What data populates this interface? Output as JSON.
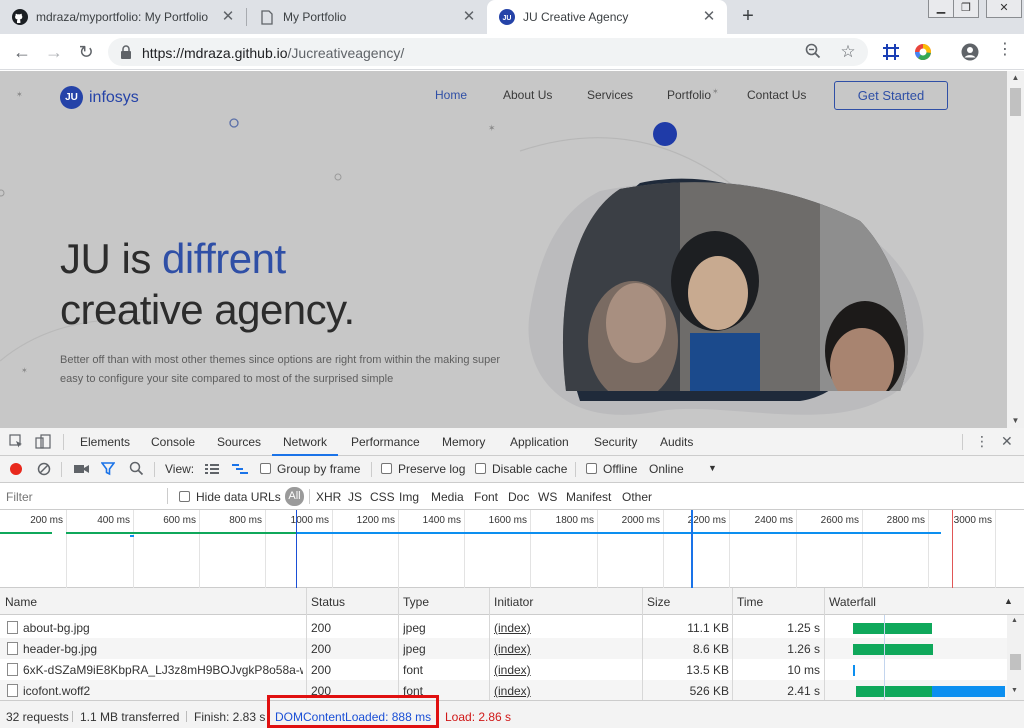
{
  "browser": {
    "tabs": [
      {
        "title": "mdraza/myportfolio: My Portfolio",
        "icon": "github-icon",
        "active": false
      },
      {
        "title": "My Portfolio",
        "icon": "page-icon",
        "active": false
      },
      {
        "title": "JU Creative Agency",
        "icon": "ju-favicon-icon",
        "active": true
      }
    ],
    "url_host": "https://mdraza.github.io",
    "url_path": "/Jucreativeagency/"
  },
  "site": {
    "logo_badge": "JU",
    "logo_name": "infosys",
    "nav": [
      "Home",
      "About Us",
      "Services",
      "Portfolio",
      "Contact Us"
    ],
    "cta": "Get Started",
    "hero_line1_plain": "JU is ",
    "hero_line1_accent": "diffrent",
    "hero_line2": "creative agency.",
    "hero_sub": "Better off than with most other themes since options are right from within the making super easy to configure your site compared to most of the surprised simple"
  },
  "devtools": {
    "tabs": [
      "Elements",
      "Console",
      "Sources",
      "Network",
      "Performance",
      "Memory",
      "Application",
      "Security",
      "Audits"
    ],
    "active_tab": "Network",
    "toolbar": {
      "view_label": "View:",
      "group_by_frame": "Group by frame",
      "preserve_log": "Preserve log",
      "disable_cache": "Disable cache",
      "offline": "Offline",
      "throttle": "Online"
    },
    "filter": {
      "placeholder": "Filter",
      "hide_data_urls": "Hide data URLs",
      "types": [
        "All",
        "XHR",
        "JS",
        "CSS",
        "Img",
        "Media",
        "Font",
        "Doc",
        "WS",
        "Manifest",
        "Other"
      ]
    },
    "overview_ticks": [
      "200 ms",
      "400 ms",
      "600 ms",
      "800 ms",
      "1000 ms",
      "1200 ms",
      "1400 ms",
      "1600 ms",
      "1800 ms",
      "2000 ms",
      "2200 ms",
      "2400 ms",
      "2600 ms",
      "2800 ms",
      "3000 ms"
    ],
    "columns": [
      "Name",
      "Status",
      "Type",
      "Initiator",
      "Size",
      "Time",
      "Waterfall"
    ],
    "rows": [
      {
        "name": "about-bg.jpg",
        "status": "200",
        "type": "jpeg",
        "initiator": "(index)",
        "size": "11.1 KB",
        "time": "1.25 s"
      },
      {
        "name": "header-bg.jpg",
        "status": "200",
        "type": "jpeg",
        "initiator": "(index)",
        "size": "8.6 KB",
        "time": "1.26 s"
      },
      {
        "name": "6xK-dSZaM9iE8KbpRA_LJ3z8mH9BOJvgkP8o58a-w...",
        "status": "200",
        "type": "font",
        "initiator": "(index)",
        "size": "13.5 KB",
        "time": "10 ms"
      },
      {
        "name": "icofont.woff2",
        "status": "200",
        "type": "font",
        "initiator": "(index)",
        "size": "526 KB",
        "time": "2.41 s"
      }
    ],
    "status": {
      "requests": "32 requests",
      "transferred": "1.1 MB transferred",
      "finish": "Finish: 2.83 s",
      "dom_loaded": "DOMContentLoaded: 888 ms",
      "load": "Load: 2.86 s"
    },
    "colors": {
      "accent": "#1a73e8",
      "dom_loaded": "#1a4fd6",
      "load": "#d01818",
      "waterfall_green": "#0fa85b",
      "waterfall_blue": "#0c8ff0"
    }
  }
}
